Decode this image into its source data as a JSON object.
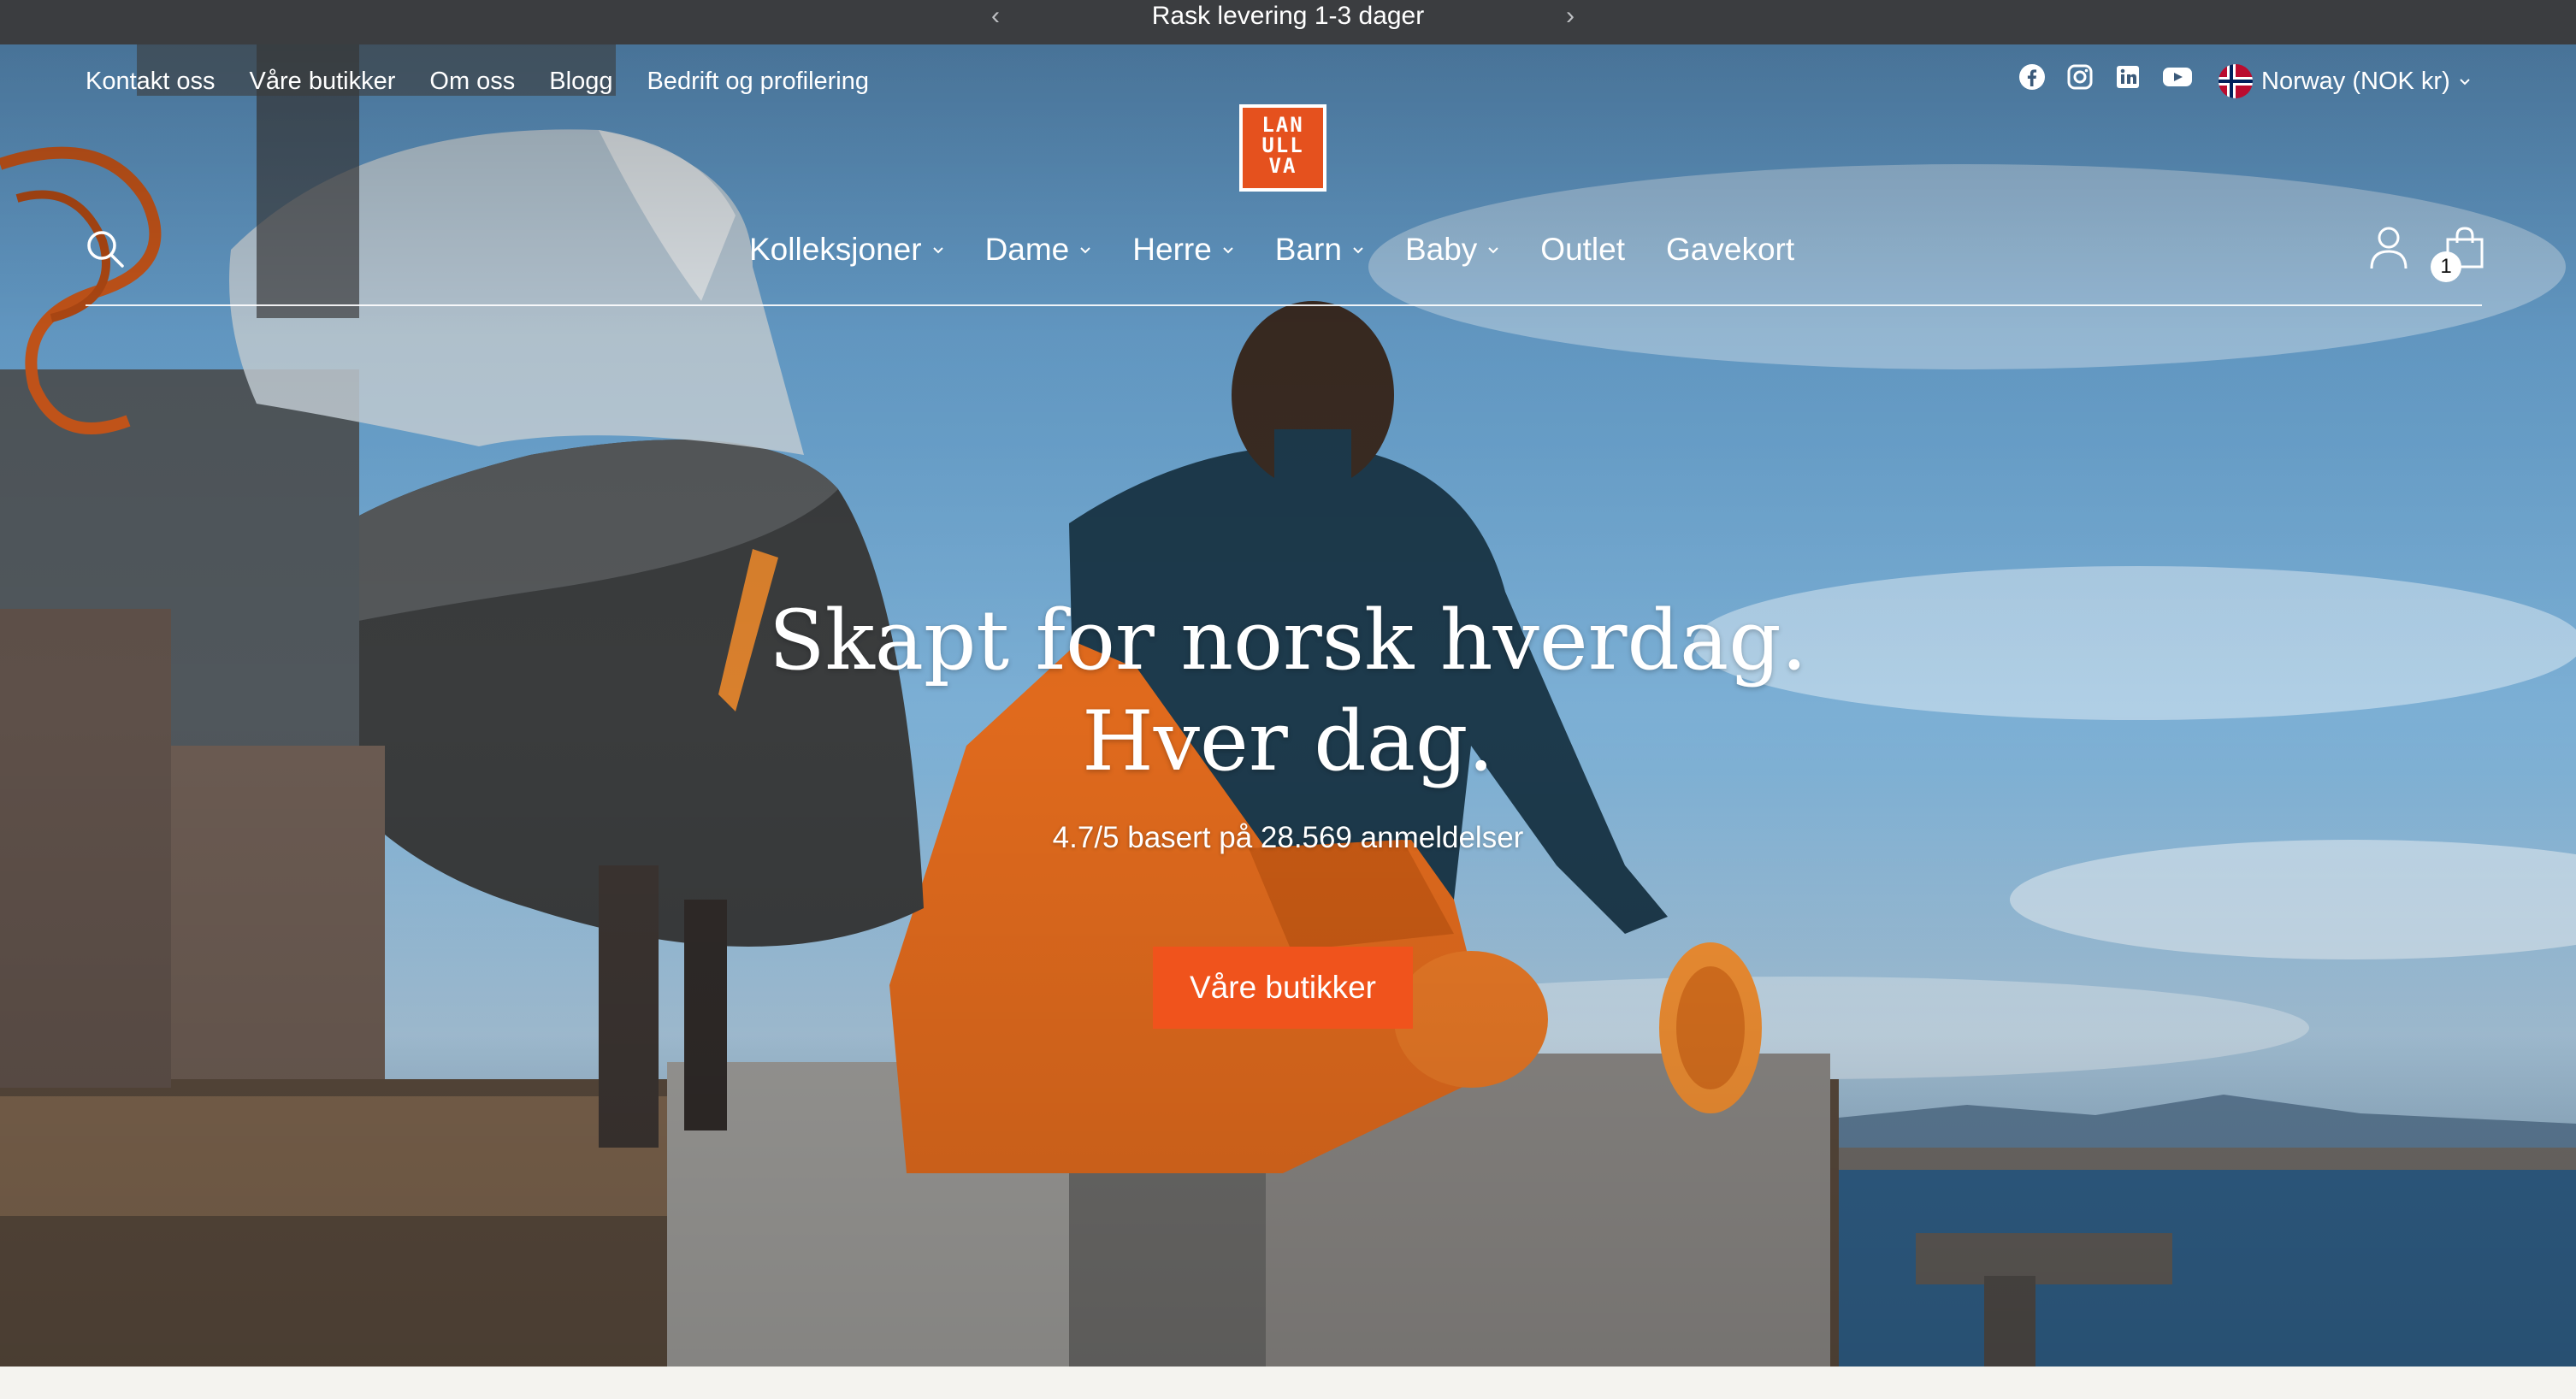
{
  "announcement": {
    "text": "Rask levering 1-3 dager",
    "prev_icon": "chevron-left-icon",
    "next_icon": "chevron-right-icon"
  },
  "utility_nav": [
    "Kontakt oss",
    "Våre butikker",
    "Om oss",
    "Blogg",
    "Bedrift og profilering"
  ],
  "social": [
    "facebook-icon",
    "instagram-icon",
    "linkedin-icon",
    "youtube-icon"
  ],
  "region": {
    "label": "Norway (NOK kr)",
    "flag": "norway-flag-icon"
  },
  "logo": {
    "lines": [
      "LAN",
      "ULL",
      "VA"
    ]
  },
  "main_nav": [
    {
      "label": "Kolleksjoner",
      "dropdown": true
    },
    {
      "label": "Dame",
      "dropdown": true
    },
    {
      "label": "Herre",
      "dropdown": true
    },
    {
      "label": "Barn",
      "dropdown": true
    },
    {
      "label": "Baby",
      "dropdown": true
    },
    {
      "label": "Outlet",
      "dropdown": false
    },
    {
      "label": "Gavekort",
      "dropdown": false
    }
  ],
  "cart": {
    "count": "1"
  },
  "hero": {
    "headline_line1": "Skapt for norsk hverdag.",
    "headline_line2": "Hver dag.",
    "rating": "4.7/5 basert på 28.569 anmeldelser",
    "cta_label": "Våre butikker"
  },
  "colors": {
    "accent": "#f0531c",
    "announcement_bg": "#3b3d40",
    "logo_bg": "#e5511e"
  }
}
